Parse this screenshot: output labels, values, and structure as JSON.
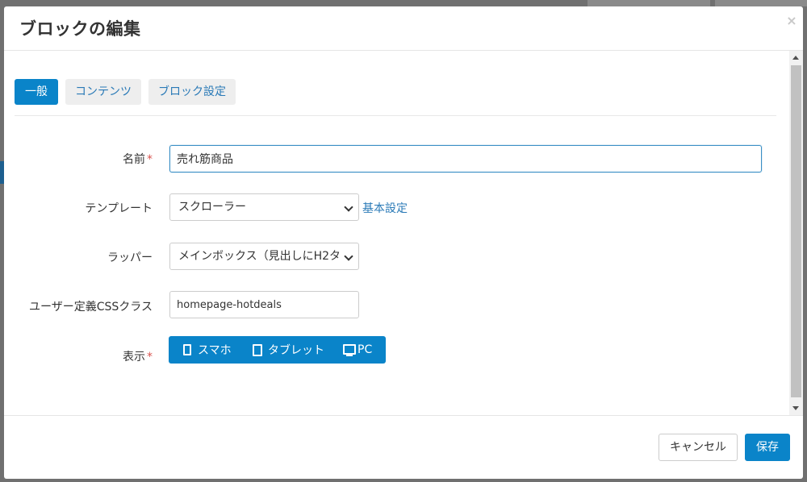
{
  "modal": {
    "title": "ブロックの編集",
    "close_glyph": "×"
  },
  "tabs": [
    {
      "label": "一般",
      "active": true
    },
    {
      "label": "コンテンツ",
      "active": false
    },
    {
      "label": "ブロック設定",
      "active": false
    }
  ],
  "form": {
    "name": {
      "label": "名前",
      "required_mark": "*",
      "value": "売れ筋商品"
    },
    "template": {
      "label": "テンプレート",
      "selected": "スクローラー",
      "link": "基本設定"
    },
    "wrapper": {
      "label": "ラッパー",
      "selected": "メインボックス（見出しにH2タ"
    },
    "css_class": {
      "label": "ユーザー定義CSSクラス",
      "value": "homepage-hotdeals"
    },
    "display": {
      "label": "表示",
      "required_mark": "*",
      "options": [
        {
          "label": "スマホ",
          "icon": "phone-icon"
        },
        {
          "label": "タブレット",
          "icon": "tablet-icon"
        },
        {
          "label": "PC",
          "icon": "monitor-icon"
        }
      ]
    }
  },
  "footer": {
    "cancel_label": "キャンセル",
    "save_label": "保存"
  },
  "colors": {
    "primary": "#0a84c9",
    "link": "#2a7ab7",
    "required": "#d9534f"
  }
}
